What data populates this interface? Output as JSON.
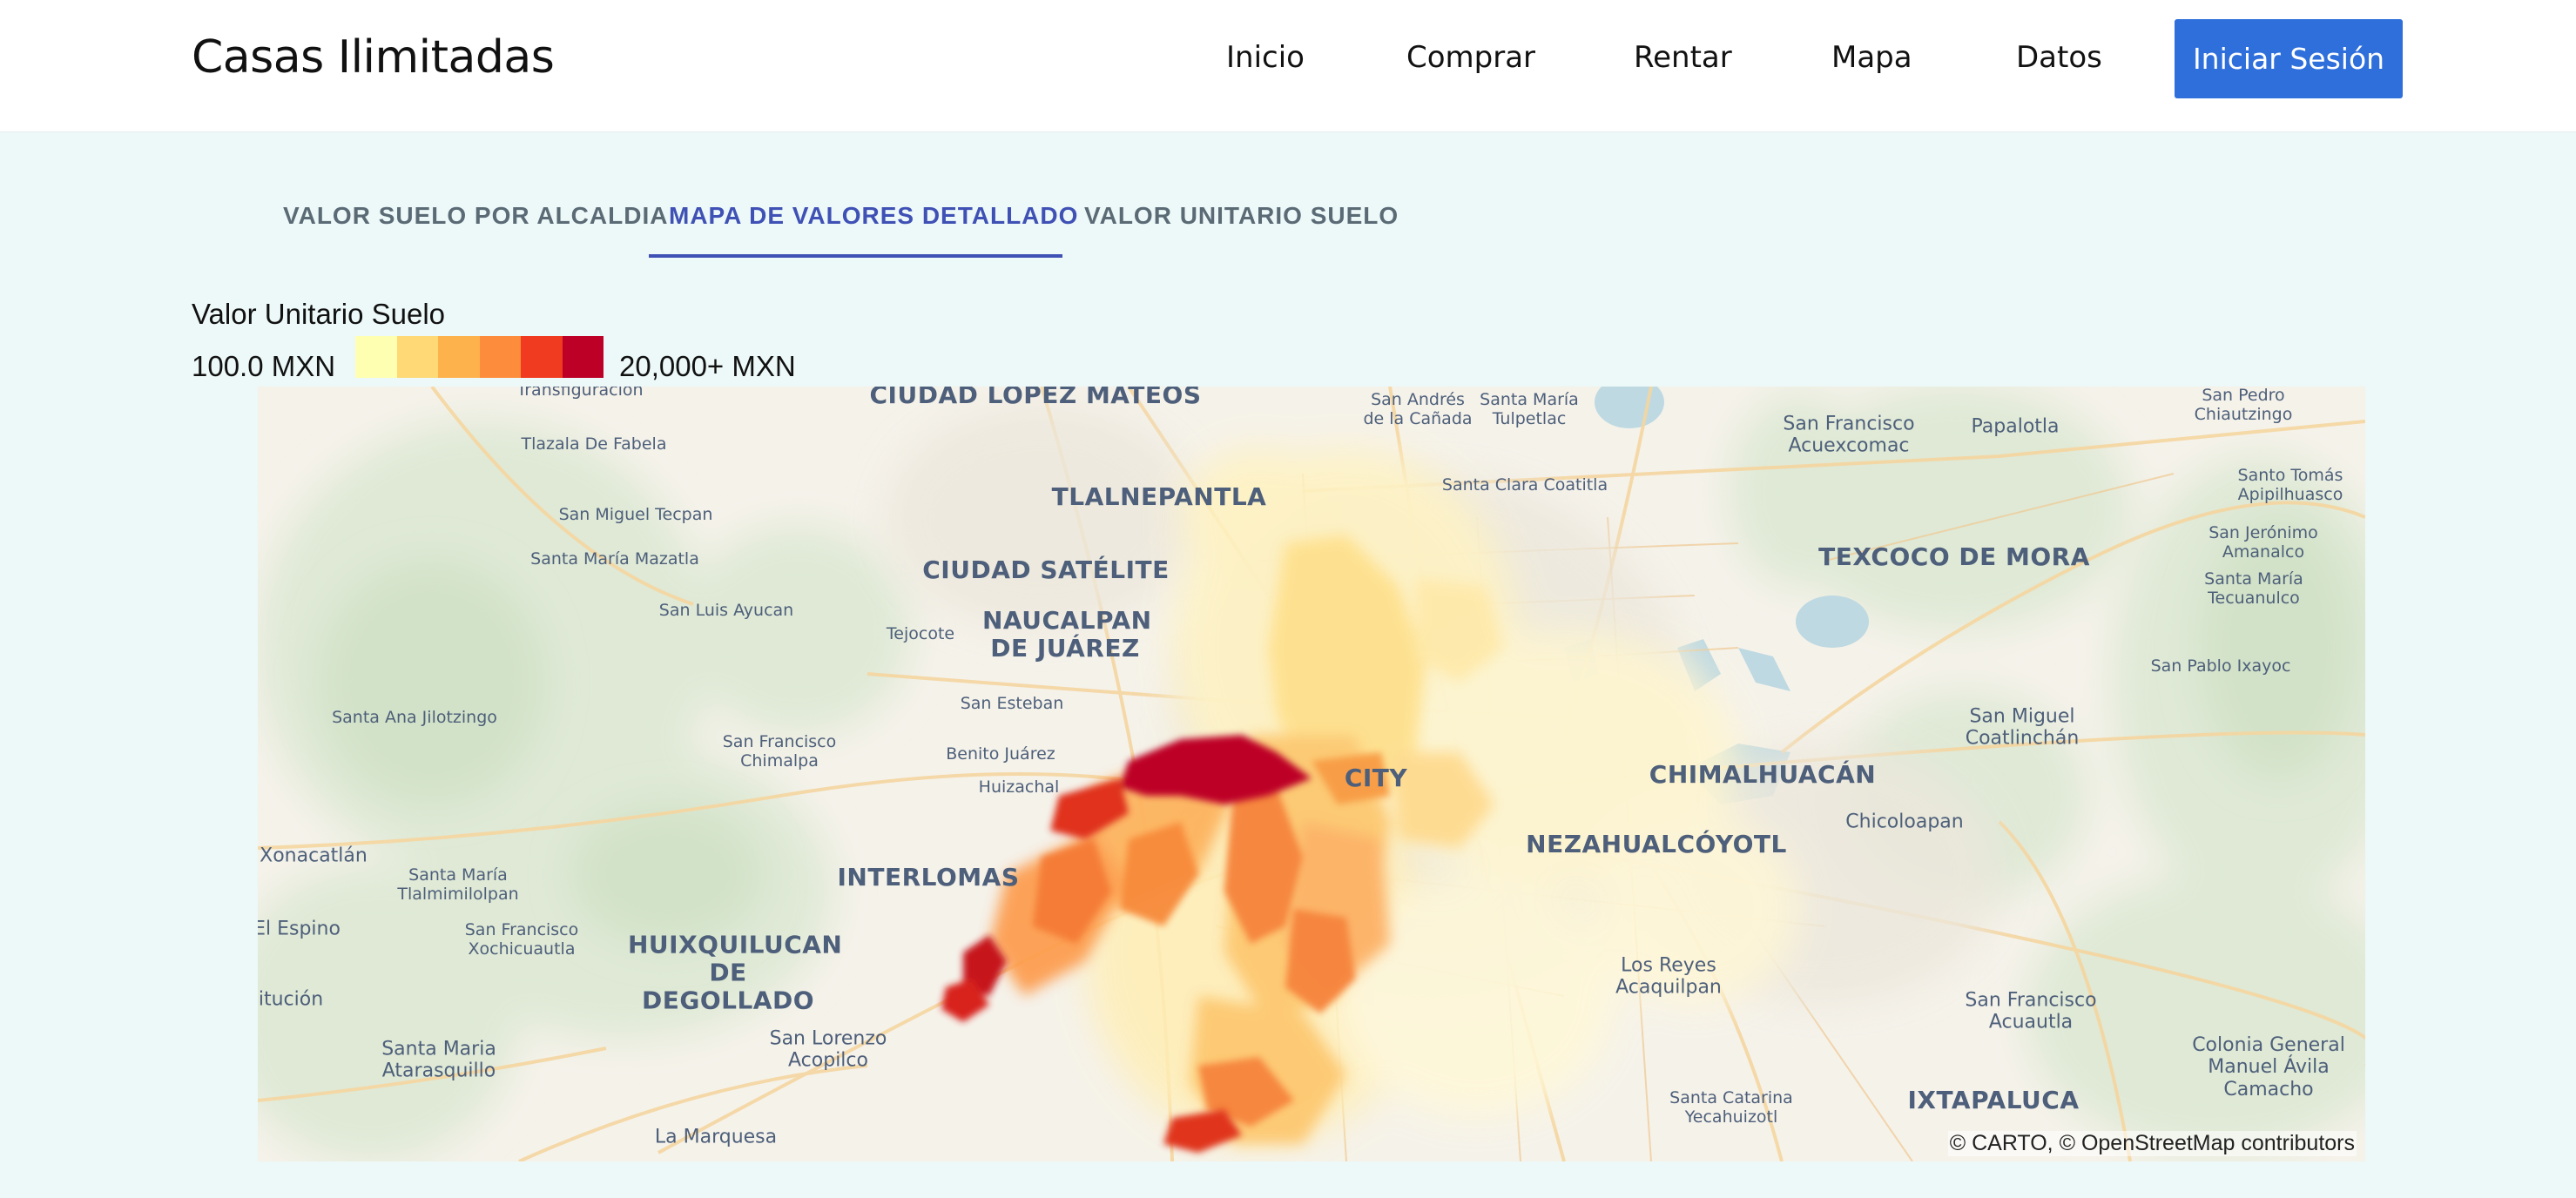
{
  "header": {
    "brand": "Casas Ilimitadas",
    "nav": [
      "Inicio",
      "Comprar",
      "Rentar",
      "Mapa",
      "Datos"
    ],
    "login_label": "Iniciar Sesión"
  },
  "tabs": [
    {
      "label": "VALOR SUELO POR ALCALDIA",
      "active": false
    },
    {
      "label": "MAPA DE VALORES DETALLADO",
      "active": true
    },
    {
      "label": "VALOR UNITARIO SUELO",
      "active": false
    }
  ],
  "legend": {
    "title": "Valor Unitario Suelo",
    "min_label": "100.0 MXN",
    "max_label": "20,000+ MXN",
    "colors": [
      "#ffffb2",
      "#fed976",
      "#feb24c",
      "#fd8d3c",
      "#f03b20",
      "#bd0026"
    ]
  },
  "map": {
    "attribution": "© CARTO, © OpenStreetMap contributors",
    "places": [
      "CIUDAD LÓPEZ MATEOS",
      "TLALNEPANTLA",
      "CIUDAD SATÉLITE",
      "NAUCALPAN DE JUÁREZ",
      "CITY",
      "NEZAHUALCÓYOTL",
      "CHIMALHUACÁN",
      "TEXCOCO DE MORA",
      "INTERLOMAS",
      "HUIXQUILUCAN DE DEGOLLADO",
      "IXTAPALUCA",
      "Transfiguración",
      "Tlazala De Fabela",
      "San Miguel Tecpan",
      "Santa María Mazatla",
      "San Luis Ayucan",
      "Tejocote",
      "San Esteban",
      "Santa Ana Jilotzingo",
      "San Francisco Chimalpa",
      "Benito Juárez",
      "Huizachal",
      "Xonacatlán",
      "Santa María Tlalmimilolpan",
      "El Espino",
      "San Francisco Xochicuautla",
      "itución",
      "Santa Maria Atarasquillo",
      "San Lorenzo Acopilco",
      "La Marquesa",
      "San Andrés de la Cañada",
      "Santa María Tulpetlac",
      "Santa Clara Coatitla",
      "San Francisco Acuexcomac",
      "Papalotla",
      "San Pedro Chiautzingo",
      "Santo Tomás Apipilhuasco",
      "San Jerónimo Amanalco",
      "Santa María Tecuanulco",
      "San Pablo Ixayoc",
      "San Miguel Coatlinchán",
      "Chicoloapan",
      "Los Reyes Acaquilpan",
      "San Francisco Acuautla",
      "Colonia General Manuel Ávila Camacho",
      "Santa Catarina Yecahuizotl"
    ]
  }
}
